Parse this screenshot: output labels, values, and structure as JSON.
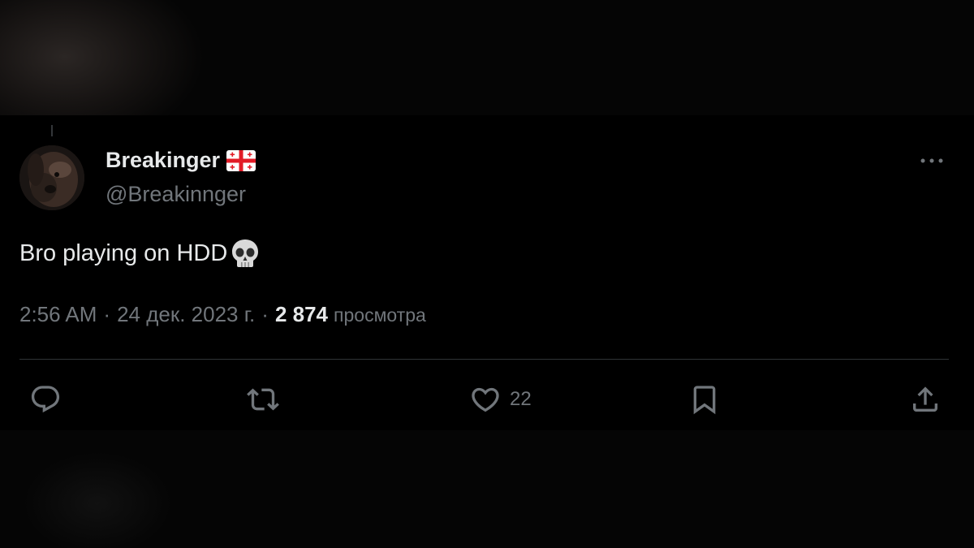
{
  "tweet": {
    "display_name": "Breakinger",
    "handle": "@Breakinnger",
    "text": "Bro playing on HDD",
    "time": "2:56 AM",
    "date": "24 дек. 2023 г.",
    "views_count": "2 874",
    "views_label": "просмотра",
    "separator": "·"
  },
  "actions": {
    "reply": {
      "icon": "reply-icon"
    },
    "retweet": {
      "icon": "retweet-icon"
    },
    "like": {
      "icon": "heart-icon",
      "count": "22"
    },
    "bookmark": {
      "icon": "bookmark-icon"
    },
    "share": {
      "icon": "share-icon"
    }
  },
  "icons": {
    "flag": "georgia-flag-icon",
    "emoji": "skull-icon",
    "more": "more-icon"
  },
  "colors": {
    "background": "#000000",
    "primary_text": "#e7e9ea",
    "secondary_text": "#71767b",
    "divider": "#2f3336"
  }
}
